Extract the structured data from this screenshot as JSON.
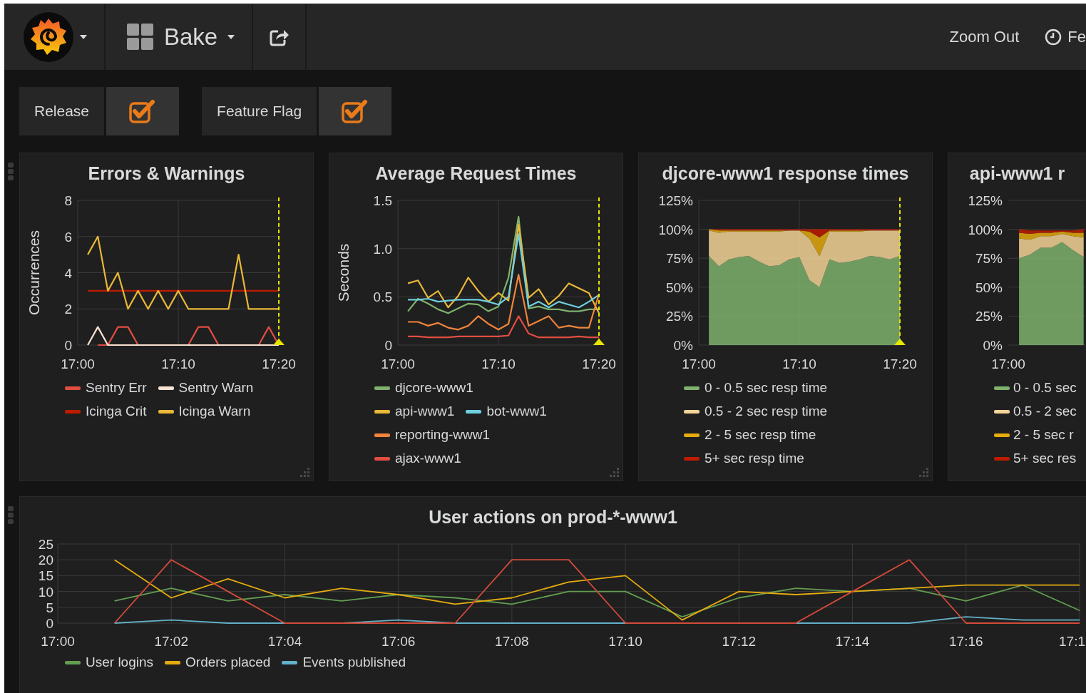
{
  "navbar": {
    "dashboard_title": "Bake",
    "zoom_out": "Zoom Out",
    "time_picker": "Fe"
  },
  "variables": [
    {
      "label": "Release",
      "checked": true
    },
    {
      "label": "Feature Flag",
      "checked": true
    }
  ],
  "panels": [
    {
      "title": "Errors & Warnings",
      "event_marker": true,
      "chart_data": {
        "type": "line",
        "ylabel": "Occurrences",
        "categories": [
          "17:00",
          null,
          null,
          null,
          null,
          null,
          null,
          null,
          null,
          null,
          "17:10",
          null,
          null,
          null,
          null,
          null,
          null,
          null,
          null,
          null,
          "17:20"
        ],
        "ylim": [
          0,
          8
        ],
        "yticks": [
          0,
          2,
          4,
          6,
          8
        ],
        "grid": true,
        "series": [
          {
            "name": "Sentry Err",
            "color": "#e24d42",
            "values": [
              null,
              null,
              0,
              0,
              1,
              1,
              0,
              0,
              0,
              0,
              0,
              0,
              1,
              1,
              0,
              0,
              0,
              0,
              0,
              1,
              0
            ]
          },
          {
            "name": "Sentry Warn",
            "color": "#f9e2d2",
            "values": [
              null,
              0,
              1,
              0,
              0,
              0,
              0,
              0,
              0,
              0,
              0,
              0,
              0,
              0,
              0,
              0,
              0,
              0,
              0,
              0,
              0
            ]
          },
          {
            "name": "Icinga Crit",
            "color": "#bf1b00",
            "values": [
              null,
              3,
              3,
              3,
              3,
              3,
              3,
              3,
              3,
              3,
              3,
              3,
              3,
              3,
              3,
              3,
              3,
              3,
              3,
              3,
              3
            ]
          },
          {
            "name": "Icinga Warn",
            "color": "#eab839",
            "values": [
              null,
              5,
              6,
              3,
              4,
              2,
              3,
              2,
              3,
              2,
              3,
              2,
              2,
              2,
              2,
              2,
              5,
              2,
              2,
              2,
              2
            ]
          }
        ]
      }
    },
    {
      "title": "Average Request Times",
      "event_marker": true,
      "chart_data": {
        "type": "line",
        "ylabel": "Seconds",
        "categories": [
          "17:00",
          null,
          null,
          null,
          null,
          null,
          null,
          null,
          null,
          null,
          "17:10",
          null,
          null,
          null,
          null,
          null,
          null,
          null,
          null,
          null,
          "17:20"
        ],
        "ylim": [
          0,
          1.5
        ],
        "yticks": [
          0,
          0.5,
          {
            "value": 1,
            "label": "1.0"
          },
          1.5
        ],
        "grid": true,
        "series": [
          {
            "name": "djcore-www1",
            "color": "#7eb26d",
            "values": [
              null,
              0.35,
              0.48,
              0.43,
              0.37,
              0.33,
              0.38,
              0.43,
              0.42,
              0.35,
              0.4,
              0.7,
              1.33,
              0.38,
              0.4,
              0.37,
              0.37,
              0.35,
              0.35,
              0.37,
              0.37
            ]
          },
          {
            "name": "api-www1",
            "color": "#eab839",
            "values": [
              null,
              0.64,
              0.67,
              0.49,
              0.56,
              0.39,
              0.51,
              0.7,
              0.56,
              0.45,
              0.54,
              0.46,
              1.25,
              0.49,
              0.58,
              0.42,
              0.51,
              0.64,
              0.59,
              0.54,
              0.33
            ]
          },
          {
            "name": "bot-www1",
            "color": "#6ed0e0",
            "values": [
              null,
              0.47,
              0.47,
              0.48,
              0.45,
              0.46,
              0.47,
              0.47,
              0.47,
              0.45,
              0.42,
              0.5,
              1.15,
              0.4,
              0.45,
              0.39,
              0.45,
              0.42,
              0.39,
              0.45,
              0.52
            ]
          },
          {
            "name": "reporting-www1",
            "color": "#ef843c",
            "values": [
              null,
              0.24,
              0.24,
              0.2,
              0.23,
              0.18,
              0.16,
              0.2,
              0.3,
              0.22,
              0.16,
              0.22,
              0.73,
              0.2,
              0.25,
              0.3,
              0.18,
              0.2,
              0.18,
              0.18,
              0.53
            ]
          },
          {
            "name": "ajax-www1",
            "color": "#e24d42",
            "values": [
              null,
              0.09,
              0.09,
              0.08,
              0.08,
              0.08,
              0.09,
              0.09,
              0.09,
              0.09,
              0.09,
              0.1,
              0.3,
              0.12,
              0.08,
              0.08,
              0.08,
              0.08,
              0.09,
              0.08,
              0.08
            ]
          }
        ]
      }
    },
    {
      "title": "djcore-www1 response times",
      "event_marker": true,
      "chart_data": {
        "type": "area",
        "stacked": true,
        "categories": [
          "17:00",
          null,
          null,
          null,
          null,
          null,
          null,
          null,
          null,
          null,
          "17:10",
          null,
          null,
          null,
          null,
          null,
          null,
          null,
          null,
          null,
          "17:20"
        ],
        "ylim": [
          0,
          125
        ],
        "yticks": [
          {
            "value": 0,
            "label": "0%"
          },
          {
            "value": 25,
            "label": "25%"
          },
          {
            "value": 50,
            "label": "50%"
          },
          {
            "value": 75,
            "label": "75%"
          },
          {
            "value": 100,
            "label": "100%"
          },
          {
            "value": 125,
            "label": "125%"
          }
        ],
        "grid": true,
        "legend": "bottom",
        "series": [
          {
            "name": "0 - 0.5 sec resp time",
            "color": "#7eb26d",
            "values": [
              null,
              77,
              68,
              74,
              76,
              77,
              72,
              68,
              69,
              74,
              76,
              56,
              50,
              74,
              71,
              72,
              74,
              77,
              76,
              74,
              77
            ]
          },
          {
            "name": "0.5 - 2 sec resp time",
            "color": "#f4d598",
            "values": [
              null,
              22,
              29,
              24,
              22,
              21,
              26,
              30,
              29,
              25,
              23,
              36,
              27,
              24,
              27,
              26,
              24,
              22,
              23,
              25,
              22
            ]
          },
          {
            "name": "2 - 5 sec resp time",
            "color": "#e5ac0e",
            "values": [
              null,
              1,
              2,
              1,
              1,
              1,
              1,
              1,
              1,
              0,
              0,
              6,
              16,
              1,
              1,
              1,
              1,
              0,
              0,
              0,
              0
            ]
          },
          {
            "name": "5+ sec resp time",
            "color": "#bf1b00",
            "values": [
              null,
              0,
              1,
              1,
              1,
              1,
              1,
              1,
              1,
              1,
              1,
              2,
              7,
              1,
              1,
              1,
              1,
              1,
              1,
              1,
              1
            ]
          }
        ]
      }
    },
    {
      "title": "api-www1 r",
      "y_axis_labels": [
        "125%",
        "100%",
        "75%",
        "50%",
        "25%",
        "0%"
      ],
      "x_axis_labels": [
        "17:00"
      ],
      "legend": [
        {
          "name": "0 - 0.5 sec",
          "color": "#7eb26d"
        },
        {
          "name": "0.5 - 2 sec",
          "color": "#f4d598"
        },
        {
          "name": "2 - 5 sec r",
          "color": "#e5ac0e"
        },
        {
          "name": "5+ sec res",
          "color": "#bf1b00"
        }
      ]
    }
  ],
  "bottom_panel": {
    "title": "User actions on prod-*-www1",
    "chart_data": {
      "type": "line",
      "categories": [
        "17:00",
        null,
        "17:02",
        null,
        "17:04",
        null,
        "17:06",
        null,
        "17:08",
        null,
        "17:10",
        null,
        "17:12",
        null,
        "17:14",
        null,
        "17:16",
        null,
        "17:1"
      ],
      "ylim": [
        0,
        25
      ],
      "yticks": [
        0,
        5,
        10,
        15,
        20,
        25
      ],
      "grid": true,
      "legend": "bottom",
      "series": [
        {
          "name": "User logins",
          "color": "#629e51",
          "values": [
            null,
            7,
            11,
            7,
            9,
            7,
            9,
            8,
            6,
            10,
            10,
            2,
            8,
            11,
            10,
            11,
            7,
            12,
            4
          ]
        },
        {
          "name": "Orders placed",
          "color": "#e5ac0e",
          "values": [
            null,
            20,
            8,
            14,
            8,
            11,
            9,
            6,
            8,
            13,
            15,
            1,
            10,
            9,
            10,
            11,
            12,
            12,
            12
          ]
        },
        {
          "name": "Events published",
          "color": "#64b0c8",
          "values": [
            null,
            0,
            1,
            0,
            0,
            0,
            1,
            0,
            0,
            0,
            0,
            0,
            0,
            0,
            0,
            0,
            2,
            1,
            1
          ]
        },
        {
          "color": "#d44a3a",
          "values": [
            null,
            0,
            20,
            10,
            0,
            0,
            0,
            0,
            20,
            20,
            0,
            0,
            0,
            0,
            10,
            20,
            0,
            0,
            0
          ]
        }
      ]
    }
  }
}
